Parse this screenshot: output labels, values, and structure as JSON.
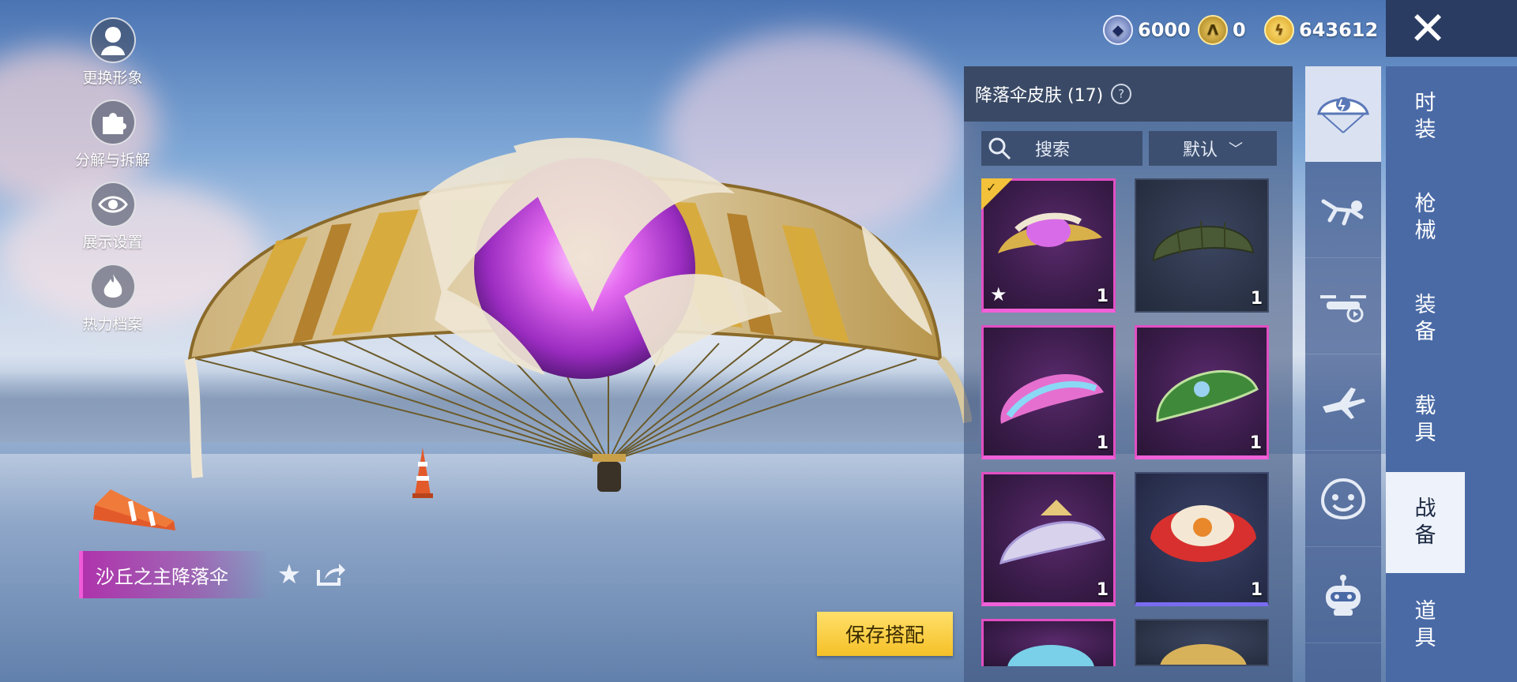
{
  "left_menu": [
    {
      "label": "更换形象",
      "icon": "avatar-icon"
    },
    {
      "label": "分解与拆解",
      "icon": "puzzle-icon"
    },
    {
      "label": "展示设置",
      "icon": "eye-icon"
    },
    {
      "label": "热力档案",
      "icon": "flame-icon"
    }
  ],
  "currency": [
    {
      "icon": "uc-coin-icon",
      "value": "6000"
    },
    {
      "icon": "gold-token-icon",
      "value": "0"
    },
    {
      "icon": "bp-coin-icon",
      "value": "643612"
    }
  ],
  "panel": {
    "title": "降落伞皮肤 (17)",
    "search_label": "搜索",
    "sort_label": "默认"
  },
  "items": [
    {
      "qty": "1",
      "rarity": "epic",
      "selected": true,
      "favorite": true,
      "color": "#d9b14a"
    },
    {
      "qty": "1",
      "rarity": "plain",
      "selected": false,
      "favorite": false,
      "color": "#4b5a36"
    },
    {
      "qty": "1",
      "rarity": "epic",
      "selected": false,
      "favorite": false,
      "color": "#e56fcf"
    },
    {
      "qty": "1",
      "rarity": "epic",
      "selected": false,
      "favorite": false,
      "color": "#3f8a3a"
    },
    {
      "qty": "1",
      "rarity": "epic",
      "selected": false,
      "favorite": false,
      "color": "#d8d2ec"
    },
    {
      "qty": "1",
      "rarity": "blue",
      "selected": false,
      "favorite": false,
      "color": "#d8302e"
    }
  ],
  "categories": [
    "parachute-icon",
    "skydive-emote-icon",
    "drone-icon",
    "airplane-icon",
    "smiley-emote-icon",
    "robot-companion-icon"
  ],
  "tabs": [
    "时装",
    "枪械",
    "装备",
    "载具",
    "战备",
    "道具"
  ],
  "active_tab": "战备",
  "item_name": "沙丘之主降落伞",
  "save_button": "保存搭配",
  "close_icon": "close-icon",
  "colors": {
    "accent_pink": "#e24fc3",
    "gold": "#f5c028",
    "tab_blue": "#4a6aa6"
  }
}
